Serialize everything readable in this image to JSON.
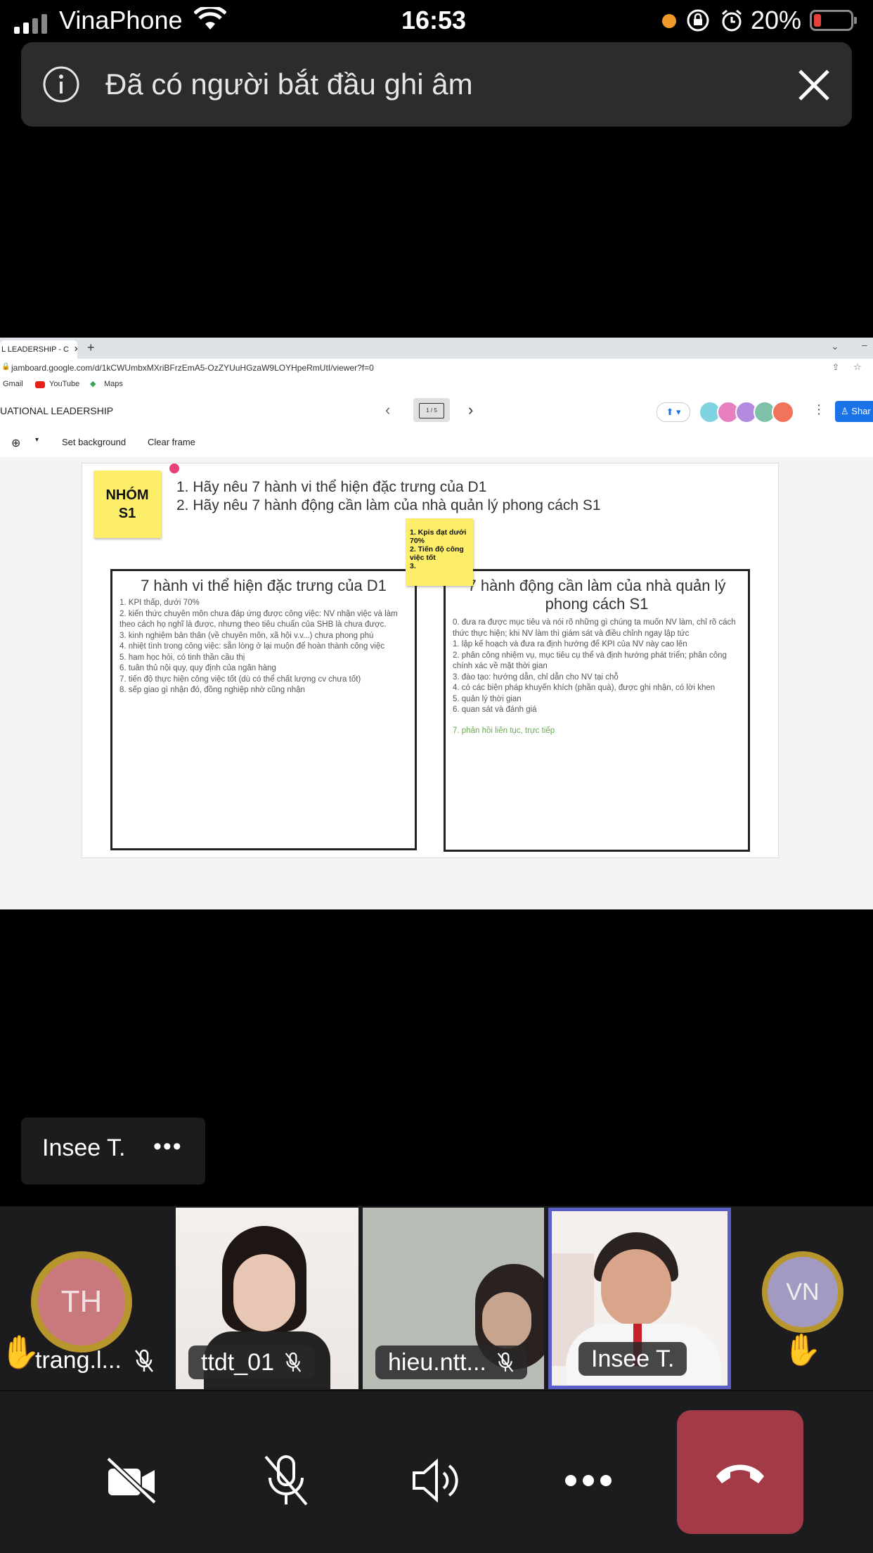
{
  "status_bar": {
    "carrier": "VinaPhone",
    "time": "16:53",
    "battery": "20%"
  },
  "toast": {
    "message": "Đã có người bắt đầu ghi âm"
  },
  "browser": {
    "tab_title": "L LEADERSHIP - C",
    "url": "jamboard.google.com/d/1kCWUmbxMXriBFrzEmA5-OzZYUuHGzaW9LOYHpeRmUtI/viewer?f=0",
    "bookmarks": [
      "Gmail",
      "YouTube",
      "Maps"
    ]
  },
  "jamboard": {
    "doc_title": "UATIONAL LEADERSHIP",
    "frame_counter": "1 / 5",
    "share_label": "Shar",
    "toolbar": {
      "set_background": "Set background",
      "clear_frame": "Clear frame"
    },
    "group_sticky": "NHÓM\nS1",
    "questions": [
      "1. Hãy nêu 7 hành vi thể hiện đặc trưng của D1",
      "2. Hãy nêu 7 hành động cần làm của nhà quản lý phong cách S1"
    ],
    "kpi_sticky": "1.  Kpis  đạt dưới 70%\n2. Tiến độ công việc tốt\n3.",
    "left_box": {
      "title": "7 hành vi thể hiện đặc trưng của D1",
      "items": [
        "1. KPI thấp, dưới 70%",
        "2. kiến thức chuyên môn chưa đáp ứng được công việc: NV nhận việc và làm theo cách họ nghĩ là được, nhưng theo tiêu chuẩn của SHB là chưa được.",
        "3. kinh nghiệm bản thân (về chuyên môn, xã hội v.v...) chưa phong phú",
        "4. nhiệt tình trong công việc: sẵn lòng ở lại muộn để hoàn thành công việc",
        "5. ham học hỏi, có tinh thần cầu thị",
        "6. tuân thủ nội quy, quy định của ngân hàng",
        "7. tiến độ thực hiện công việc tốt (dù có thể chất lượng cv chưa tốt)",
        "8. sếp giao gì nhận đó, đồng nghiệp nhờ cũng nhận"
      ]
    },
    "right_box": {
      "title": "7 hành động cần làm của nhà quản lý phong cách S1",
      "items": [
        "0. đưa ra được mục tiêu và nói rõ những gì chúng ta muốn NV làm, chỉ rõ cách thức thực hiện; khi NV làm thì giám sát và điều chỉnh ngay lập tức",
        "1. lập kế hoạch và đưa ra định hướng để KPI của NV này cao lên",
        "2. phân công nhiệm vụ, mục tiêu cụ thể và định hướng phát triển; phân công chính xác về mặt thời gian",
        "3. đào tạo: hướng dẫn, chỉ dẫn cho NV tại chỗ",
        "4. có các biện pháp khuyến khích (phần quà), được ghi nhận, có lời khen",
        "5. quản lý thời gian",
        "6. quan sát và đánh giá"
      ],
      "highlight_item": "7. phản hồi liên tục, trực tiếp"
    }
  },
  "speaker_card": {
    "name": "Insee T.",
    "more": "•••"
  },
  "participants": [
    {
      "name": "trang.l...",
      "initials": "TH",
      "hand_raised": true,
      "muted": true
    },
    {
      "name": "ttdt_01",
      "muted": true
    },
    {
      "name": "hieu.ntt...",
      "muted": true
    },
    {
      "name": "Insee T.",
      "active": true
    },
    {
      "initials": "VN",
      "hand_raised": true
    }
  ],
  "controls": {
    "camera": "camera-off",
    "mic": "mic-off",
    "speaker": "speaker",
    "more": "more",
    "end_call": "end-call"
  },
  "colors": {
    "end_call": "#a33a48",
    "active_tile_border": "#5b5fc7",
    "avatar_ring": "#b8962e",
    "sticky": "#fdee6a"
  }
}
